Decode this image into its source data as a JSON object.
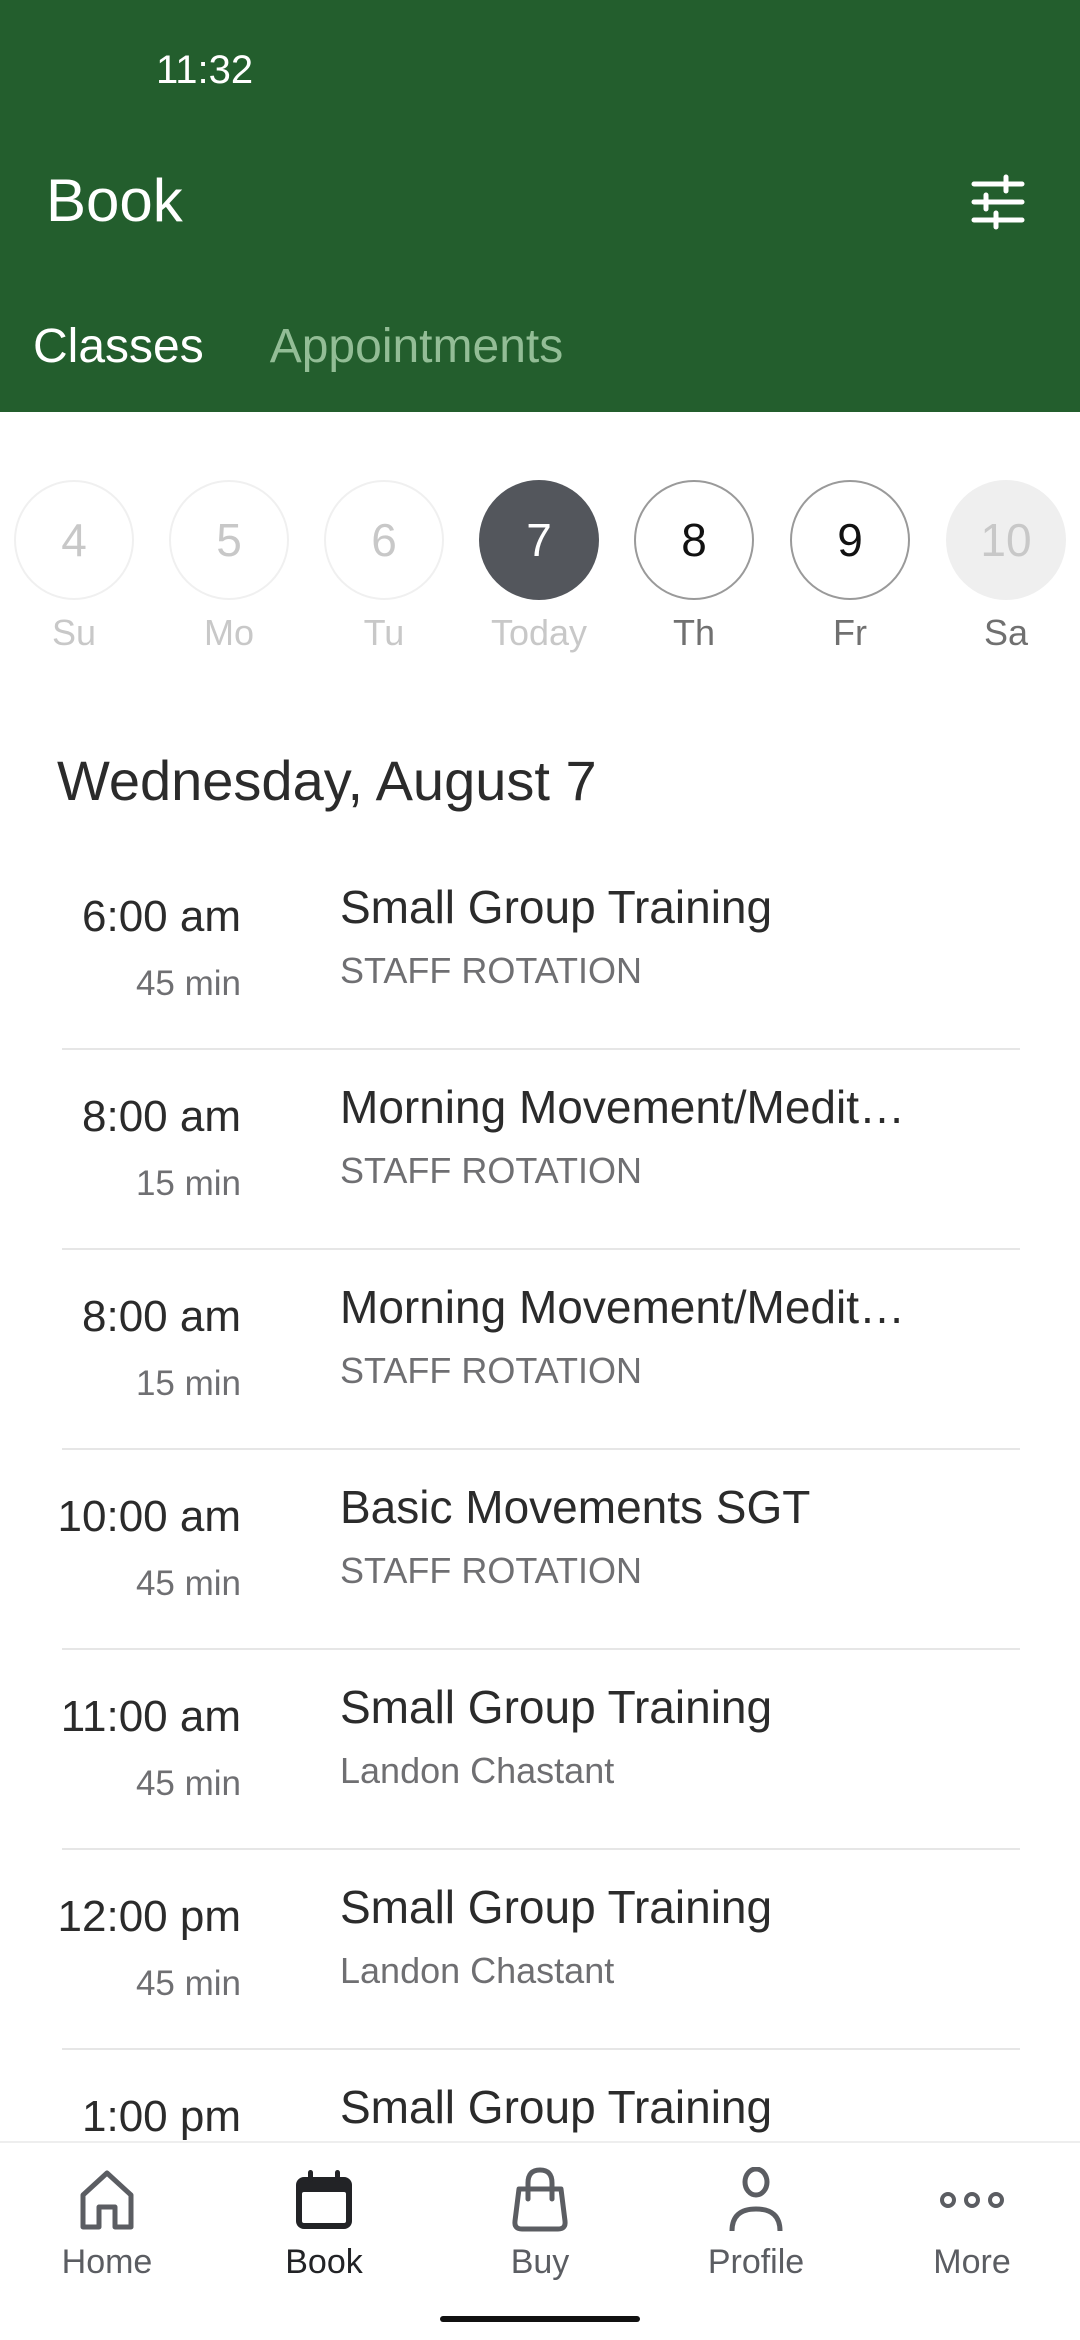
{
  "status_bar": {
    "time": "11:32"
  },
  "header": {
    "title": "Book",
    "filter_icon": "sliders-icon",
    "tabs": [
      {
        "label": "Classes",
        "active": true
      },
      {
        "label": "Appointments",
        "active": false
      }
    ]
  },
  "date_strip": {
    "days": [
      {
        "number": "4",
        "label": "Su",
        "state": "past"
      },
      {
        "number": "5",
        "label": "Mo",
        "state": "past"
      },
      {
        "number": "6",
        "label": "Tu",
        "state": "past"
      },
      {
        "number": "7",
        "label": "Today",
        "state": "today"
      },
      {
        "number": "8",
        "label": "Th",
        "state": "upcoming"
      },
      {
        "number": "9",
        "label": "Fr",
        "state": "upcoming"
      },
      {
        "number": "10",
        "label": "Sa",
        "state": "unavailable"
      }
    ]
  },
  "schedule": {
    "date_heading": "Wednesday, August 7",
    "classes": [
      {
        "time": "6:00 am",
        "duration": "45 min",
        "name": "Small Group Training",
        "instructor": "STAFF ROTATION"
      },
      {
        "time": "8:00 am",
        "duration": "15 min",
        "name": "Morning Movement/Medit…",
        "instructor": "STAFF ROTATION"
      },
      {
        "time": "8:00 am",
        "duration": "15 min",
        "name": "Morning Movement/Medit…",
        "instructor": "STAFF ROTATION"
      },
      {
        "time": "10:00 am",
        "duration": "45 min",
        "name": "Basic Movements SGT",
        "instructor": "STAFF ROTATION"
      },
      {
        "time": "11:00 am",
        "duration": "45 min",
        "name": "Small Group Training",
        "instructor": "Landon Chastant"
      },
      {
        "time": "12:00 pm",
        "duration": "45 min",
        "name": "Small Group Training",
        "instructor": "Landon Chastant"
      },
      {
        "time": "1:00 pm",
        "duration": "",
        "name": "Small Group Training",
        "instructor": ""
      }
    ]
  },
  "bottom_nav": {
    "items": [
      {
        "label": "Home",
        "icon": "home-icon",
        "active": false
      },
      {
        "label": "Book",
        "icon": "calendar-icon",
        "active": true
      },
      {
        "label": "Buy",
        "icon": "shopping-bag-icon",
        "active": false
      },
      {
        "label": "Profile",
        "icon": "person-icon",
        "active": false
      },
      {
        "label": "More",
        "icon": "more-dots-icon",
        "active": false
      }
    ]
  },
  "colors": {
    "brand_green": "#235e2d",
    "inactive_tab": "#93bd96",
    "today_fill": "#53565c",
    "text_primary": "#2b2b2b",
    "text_secondary": "#6f6f72"
  }
}
